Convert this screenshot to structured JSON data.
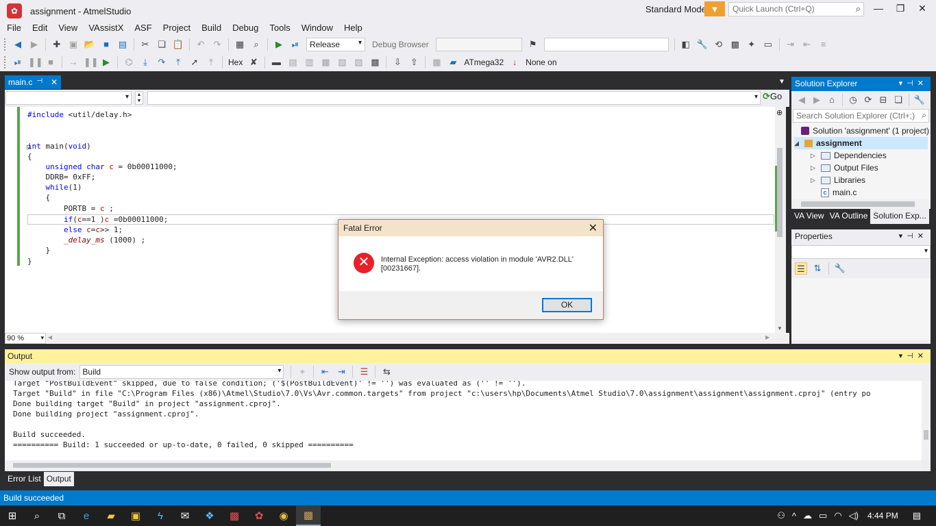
{
  "window": {
    "title": "assignment - AtmelStudio",
    "mode": "Standard Mode",
    "quick_launch_placeholder": "Quick Launch (Ctrl+Q)"
  },
  "menu": [
    "File",
    "Edit",
    "View",
    "VAssistX",
    "ASF",
    "Project",
    "Build",
    "Debug",
    "Tools",
    "Window",
    "Help"
  ],
  "toolbar": {
    "configuration": "Release",
    "debug_browser": "Debug Browser",
    "number_format": "Hex",
    "device": "ATmega32",
    "tool": "None on"
  },
  "editor": {
    "tab_label": "main.c",
    "go_label": "Go",
    "zoom": "90 %",
    "code_lines": [
      "#include <util/delay.h>",
      "",
      "",
      "int main(void)",
      "{",
      "    unsigned char c = 0b00011000;",
      "    DDRB= 0xFF;",
      "    while(1)",
      "    {",
      "        PORTB = c ;",
      "        if(c==1 )c =0b00011000;",
      "        else c=c>> 1;",
      "        _delay_ms (1000) ;",
      "    }",
      "}"
    ]
  },
  "solution_explorer": {
    "title": "Solution Explorer",
    "search_placeholder": "Search Solution Explorer (Ctrl+;)",
    "solution": "Solution 'assignment' (1 project)",
    "project": "assignment",
    "items": [
      "Dependencies",
      "Output Files",
      "Libraries",
      "main.c"
    ],
    "tabs": [
      "VA View",
      "VA Outline",
      "Solution Exp..."
    ]
  },
  "properties": {
    "title": "Properties"
  },
  "output": {
    "title": "Output",
    "show_from_label": "Show output from:",
    "source": "Build",
    "lines": [
      "Target \"PostBuildEvent\" skipped, due to false condition; ('$(PostBuildEvent)' != '') was evaluated as ('' != '').",
      "Target \"Build\" in file \"C:\\Program Files (x86)\\Atmel\\Studio\\7.0\\Vs\\Avr.common.targets\" from project \"c:\\users\\hp\\Documents\\Atmel Studio\\7.0\\assignment\\assignment\\assignment.cproj\" (entry po",
      "Done building target \"Build\" in project \"assignment.cproj\".",
      "Done building project \"assignment.cproj\".",
      "",
      "Build succeeded.",
      "========== Build: 1 succeeded or up-to-date, 0 failed, 0 skipped =========="
    ]
  },
  "bottom_tabs": [
    "Error List",
    "Output"
  ],
  "status": "Build succeeded",
  "dialog": {
    "title": "Fatal Error",
    "message": "Internal Exception: access violation in module 'AVR2.DLL' [00231667].",
    "ok_label": "OK"
  },
  "taskbar": {
    "time": "4:44 PM"
  }
}
